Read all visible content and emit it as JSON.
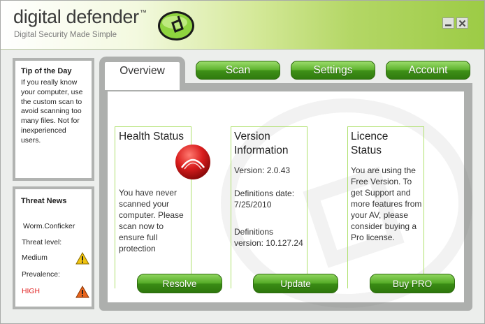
{
  "header": {
    "brand": "digital defender",
    "trademark": "™",
    "tagline": "Digital Security Made Simple",
    "logo_icon": "defender-d-logo-icon",
    "minimize_icon": "minimize-icon",
    "close_icon": "close-icon"
  },
  "tip": {
    "title": "Tip of the Day",
    "text": "If you really know your computer, use the custom scan to avoid scanning too many files. Not for inexperienced users."
  },
  "news": {
    "title": "Threat News",
    "threat_name": "Worm.Conficker",
    "threat_level_label": "Threat level:",
    "threat_level_value": "Medium",
    "prevalence_label": "Prevalence:",
    "prevalence_value": "HIGH",
    "medium_icon": "warning-yellow-icon",
    "high_icon": "warning-orange-icon"
  },
  "tabs": [
    {
      "label": "Overview",
      "active": true
    },
    {
      "label": "Scan",
      "active": false
    },
    {
      "label": "Settings",
      "active": false
    },
    {
      "label": "Account",
      "active": false
    }
  ],
  "health": {
    "title": "Health Status",
    "text": "You have never scanned your computer. Please scan now to ensure full protection",
    "button": "Resolve",
    "status_color": "#d91d1d"
  },
  "version": {
    "title_line1": "Version",
    "title_line2": "Information",
    "version": "Version: 2.0.43",
    "defs_date_label": "Definitions date:",
    "defs_date_value": "7/25/2010",
    "defs_version_label": "Definitions",
    "defs_version_value": "version: 10.127.24",
    "button": "Update"
  },
  "licence": {
    "title_line1": "Licence",
    "title_line2": "Status",
    "text": "You are using the Free Version. To get Support and more features from your AV, please consider buying a Pro license.",
    "button": "Buy PRO"
  },
  "colors": {
    "accent_green": "#4da21f",
    "card_border": "#aee06c",
    "warning_yellow": "#f1c40f",
    "warning_orange": "#e8641c",
    "high_text": "#e02020"
  }
}
